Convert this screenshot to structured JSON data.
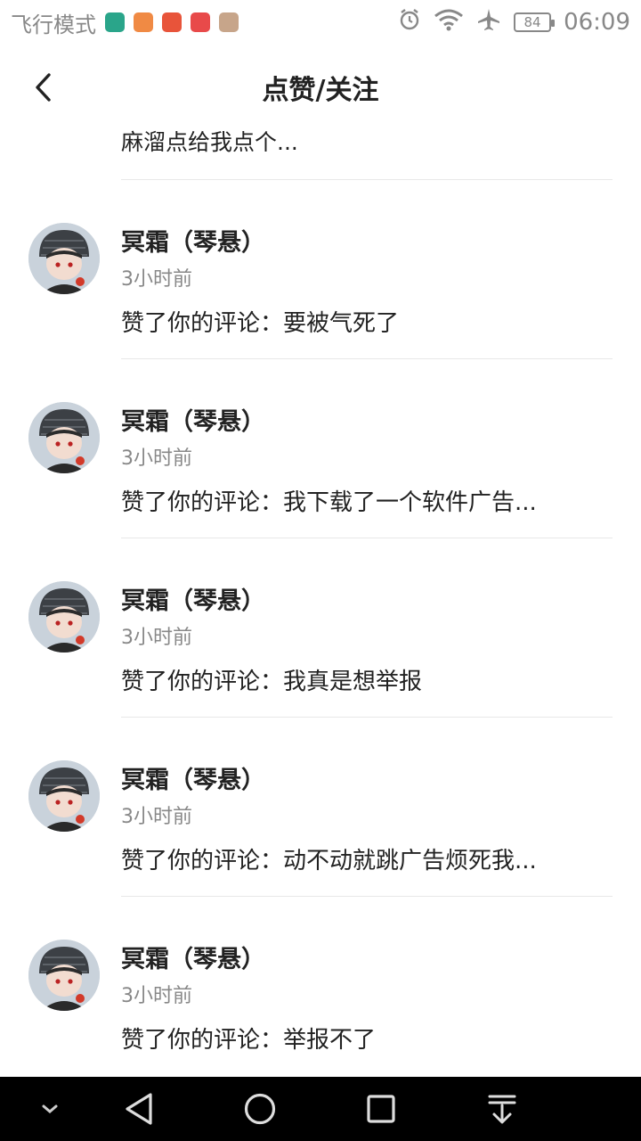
{
  "status_bar": {
    "mode_text": "飞行模式",
    "battery": "84",
    "time": "06:09",
    "app_icons": [
      {
        "name": "app-icon-1",
        "color": "#2aa58a"
      },
      {
        "name": "app-icon-2",
        "color": "#f08a44"
      },
      {
        "name": "app-icon-3",
        "color": "#e8543a"
      },
      {
        "name": "app-icon-4",
        "color": "#e84a4a"
      },
      {
        "name": "app-icon-5",
        "color": "#c7a58a"
      }
    ]
  },
  "header": {
    "title": "点赞/关注"
  },
  "partial_item": {
    "action": "麻溜点给我点个..."
  },
  "items": [
    {
      "name": "冥霜（琴悬）",
      "time": "3小时前",
      "action": "赞了你的评论：要被气死了"
    },
    {
      "name": "冥霜（琴悬）",
      "time": "3小时前",
      "action": "赞了你的评论：我下载了一个软件广告..."
    },
    {
      "name": "冥霜（琴悬）",
      "time": "3小时前",
      "action": "赞了你的评论：我真是想举报"
    },
    {
      "name": "冥霜（琴悬）",
      "time": "3小时前",
      "action": "赞了你的评论：动不动就跳广告烦死我..."
    },
    {
      "name": "冥霜（琴悬）",
      "time": "3小时前",
      "action": "赞了你的评论：举报不了"
    }
  ]
}
